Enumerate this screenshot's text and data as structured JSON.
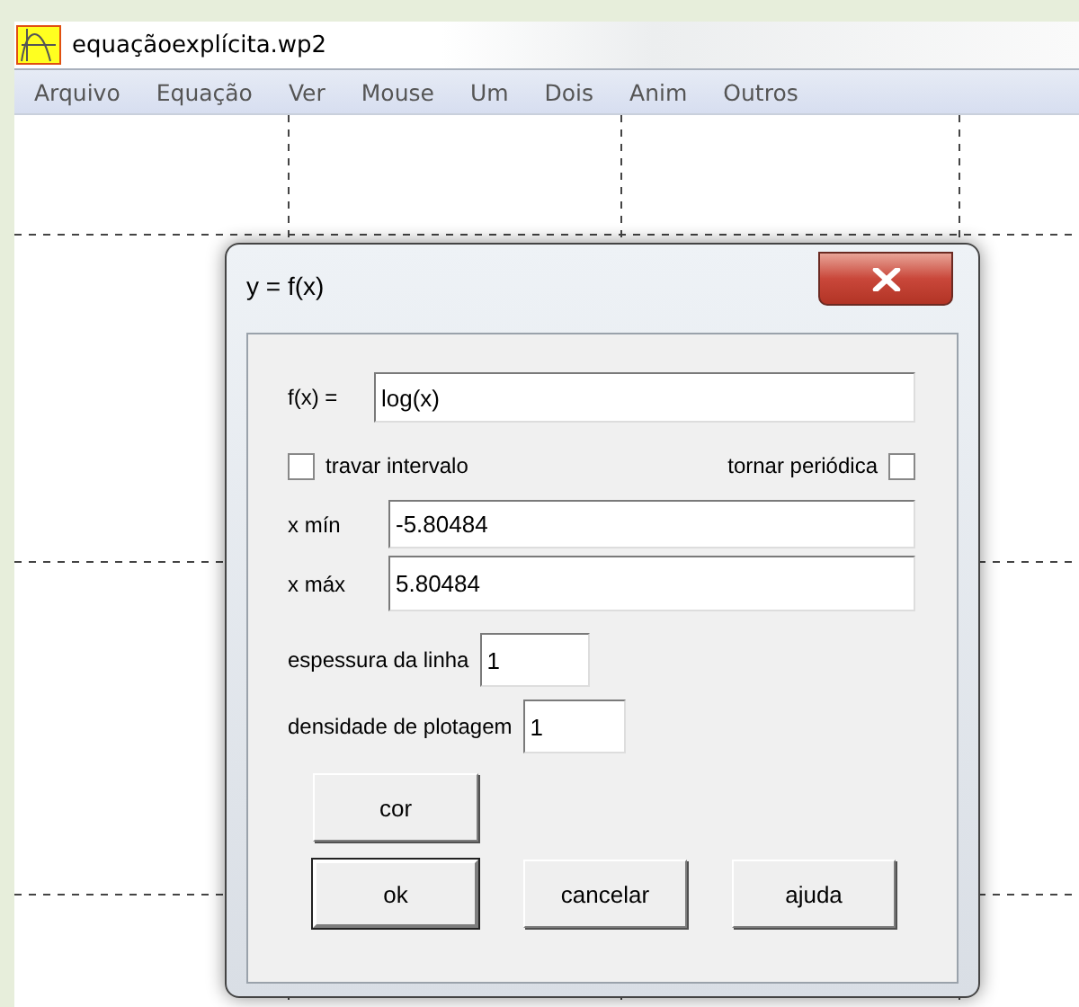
{
  "window": {
    "title": "equaçãoexplícita.wp2"
  },
  "menu": [
    "Arquivo",
    "Equação",
    "Ver",
    "Mouse",
    "Um",
    "Dois",
    "Anim",
    "Outros"
  ],
  "dialog": {
    "title": "y = f(x)",
    "function": {
      "label": "f(x) =",
      "value": "log(x)"
    },
    "checkboxes": [
      {
        "label": "travar intervalo",
        "checked": false,
        "kind": "boxfirst"
      },
      {
        "label": "tornar periódica",
        "checked": false,
        "kind": "labelfirst"
      }
    ],
    "range": [
      {
        "label": "x mín",
        "value": "-5.80484"
      },
      {
        "label": "x máx",
        "value": "5.80484"
      }
    ],
    "settings": [
      {
        "label": "espessura da linha",
        "value": "1"
      },
      {
        "label": "densidade de plotagem",
        "value": "1"
      }
    ],
    "color_button": "cor",
    "buttons": [
      {
        "label": "ok",
        "default": true
      },
      {
        "label": "cancelar",
        "default": false
      },
      {
        "label": "ajuda",
        "default": false
      }
    ]
  }
}
